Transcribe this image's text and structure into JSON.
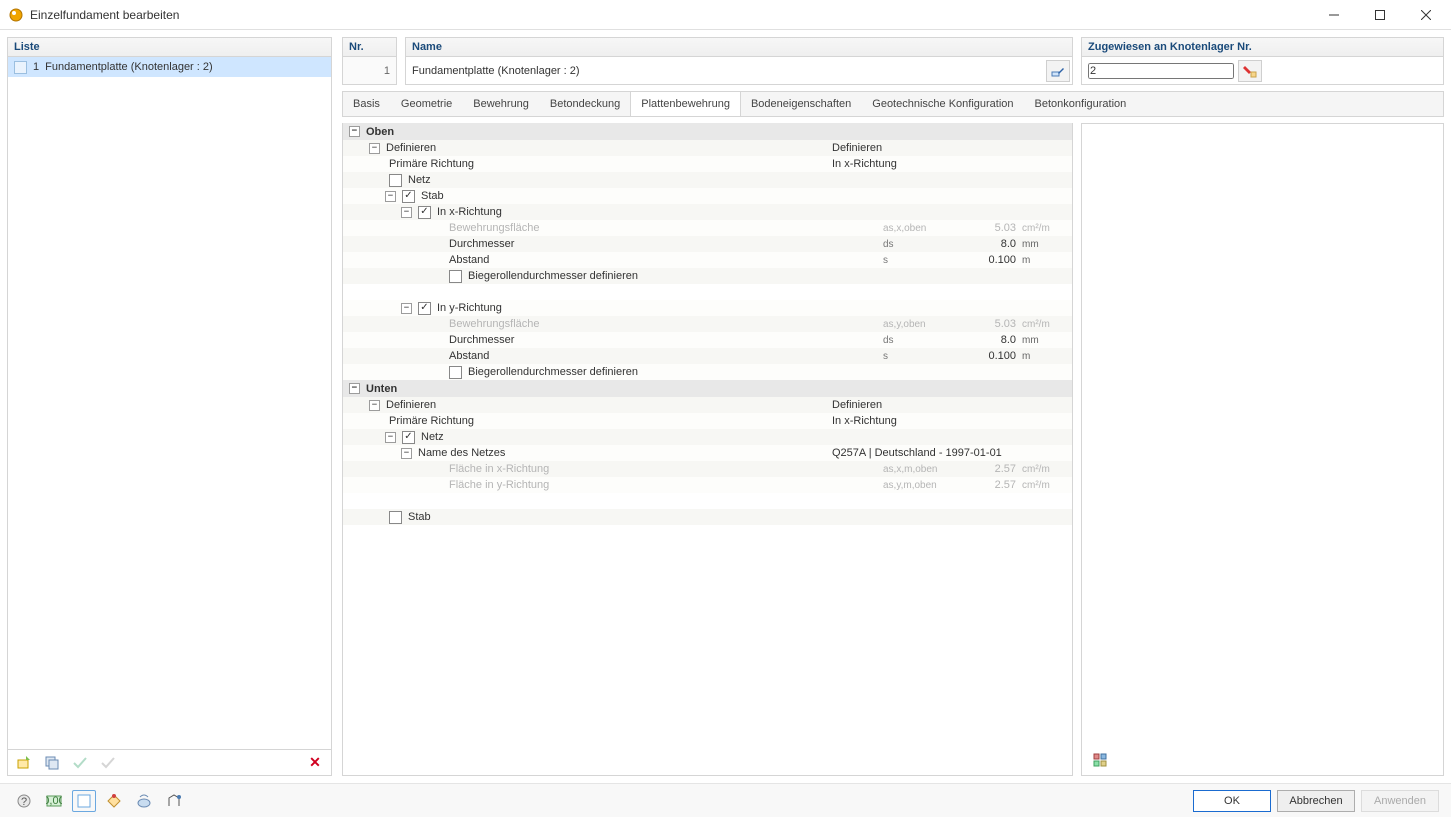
{
  "window": {
    "title": "Einzelfundament bearbeiten"
  },
  "left": {
    "header": "Liste",
    "items": [
      {
        "num": "1",
        "label": "Fundamentplatte (Knotenlager : 2)"
      }
    ]
  },
  "top": {
    "nr_label": "Nr.",
    "nr_value": "1",
    "name_label": "Name",
    "name_value": "Fundamentplatte (Knotenlager : 2)",
    "assigned_label": "Zugewiesen an Knotenlager Nr.",
    "assigned_value": "2"
  },
  "tabs": [
    "Basis",
    "Geometrie",
    "Bewehrung",
    "Betondeckung",
    "Plattenbewehrung",
    "Bodeneigenschaften",
    "Geotechnische Konfiguration",
    "Betonkonfiguration"
  ],
  "active_tab": 4,
  "tree": {
    "oben": {
      "title": "Oben",
      "def": {
        "label": "Definieren",
        "right_label": "Definieren"
      },
      "primrichtung": {
        "label": "Primäre Richtung",
        "right": "In x-Richtung"
      },
      "netz": {
        "label": "Netz",
        "checked": false
      },
      "stab": {
        "label": "Stab",
        "checked": true,
        "x": {
          "label": "In x-Richtung",
          "checked": true,
          "bewfl": {
            "label": "Bewehrungsfläche",
            "sym": "as,x,oben",
            "val": "5.03",
            "unit": "cm²/m"
          },
          "durch": {
            "label": "Durchmesser",
            "sym": "ds",
            "val": "8.0",
            "unit": "mm"
          },
          "abst": {
            "label": "Abstand",
            "sym": "s",
            "val": "0.100",
            "unit": "m"
          },
          "biege": {
            "label": "Biegerollendurchmesser definieren",
            "checked": false
          }
        },
        "y": {
          "label": "In y-Richtung",
          "checked": true,
          "bewfl": {
            "label": "Bewehrungsfläche",
            "sym": "as,y,oben",
            "val": "5.03",
            "unit": "cm²/m"
          },
          "durch": {
            "label": "Durchmesser",
            "sym": "ds",
            "val": "8.0",
            "unit": "mm"
          },
          "abst": {
            "label": "Abstand",
            "sym": "s",
            "val": "0.100",
            "unit": "m"
          },
          "biege": {
            "label": "Biegerollendurchmesser definieren",
            "checked": false
          }
        }
      }
    },
    "unten": {
      "title": "Unten",
      "def": {
        "label": "Definieren",
        "right_label": "Definieren"
      },
      "primrichtung": {
        "label": "Primäre Richtung",
        "right": "In x-Richtung"
      },
      "netz": {
        "label": "Netz",
        "checked": true,
        "name": {
          "label": "Name des Netzes",
          "right": "Q257A | Deutschland - 1997-01-01"
        },
        "fx": {
          "label": "Fläche in x-Richtung",
          "sym": "as,x,m,oben",
          "val": "2.57",
          "unit": "cm²/m"
        },
        "fy": {
          "label": "Fläche in y-Richtung",
          "sym": "as,y,m,oben",
          "val": "2.57",
          "unit": "cm²/m"
        }
      },
      "stab": {
        "label": "Stab",
        "checked": false
      }
    }
  },
  "footer": {
    "ok": "OK",
    "cancel": "Abbrechen",
    "apply": "Anwenden"
  }
}
